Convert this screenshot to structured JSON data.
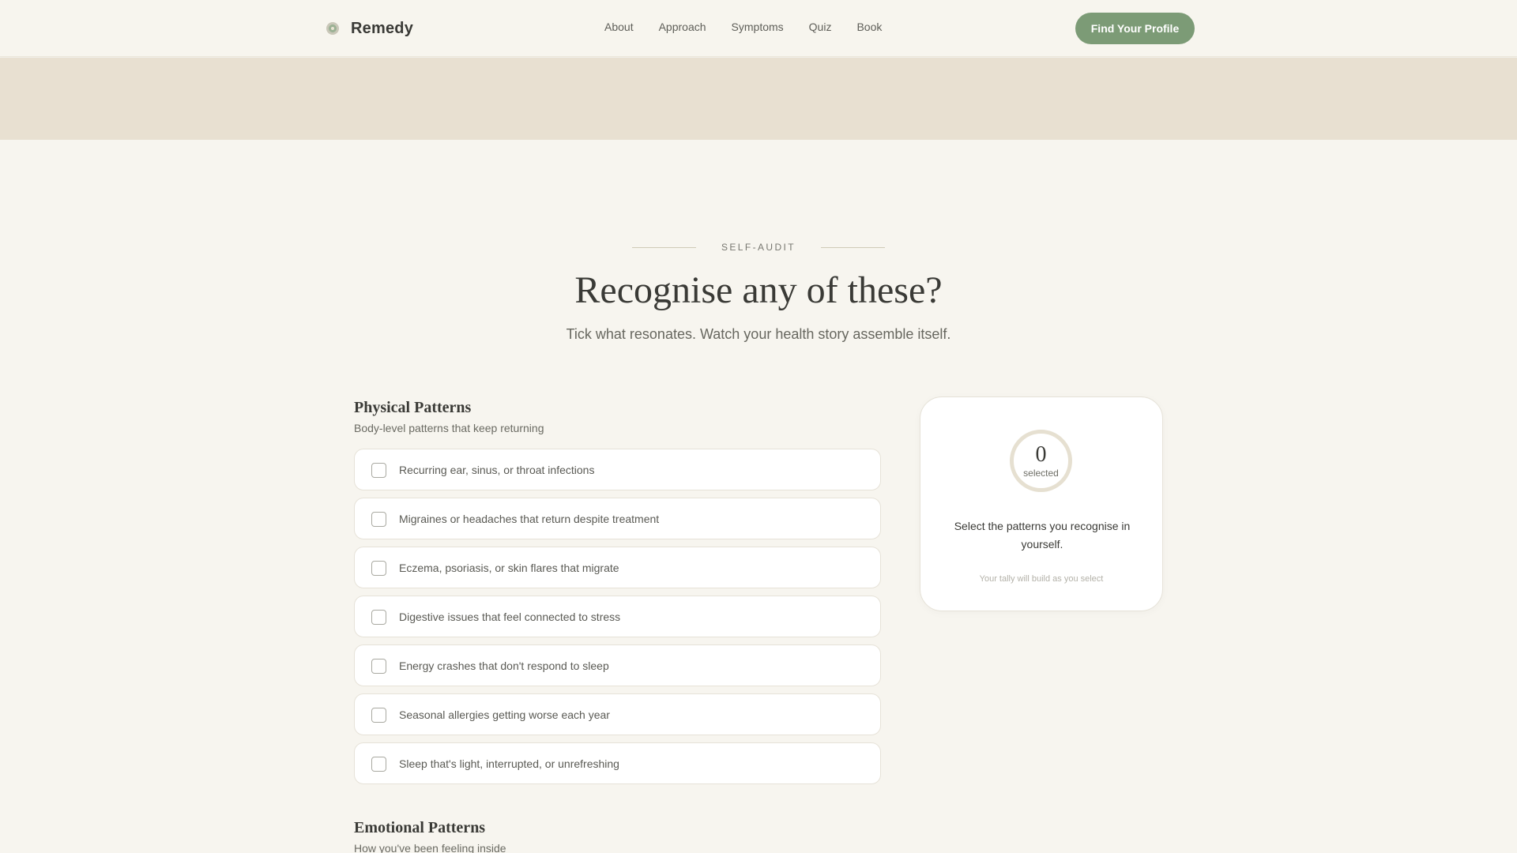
{
  "nav": {
    "brand": "Remedy",
    "links": [
      "About",
      "Approach",
      "Symptoms",
      "Quiz",
      "Book"
    ],
    "cta": "Find Your Profile"
  },
  "section": {
    "eyebrow": "SELF-AUDIT",
    "title": "Recognise any of these?",
    "subtitle": "Tick what resonates. Watch your health story assemble itself."
  },
  "groups": [
    {
      "title": "Physical Patterns",
      "subtitle": "Body-level patterns that keep returning",
      "items": [
        "Recurring ear, sinus, or throat infections",
        "Migraines or headaches that return despite treatment",
        "Eczema, psoriasis, or skin flares that migrate",
        "Digestive issues that feel connected to stress",
        "Energy crashes that don't respond to sleep",
        "Seasonal allergies getting worse each year",
        "Sleep that's light, interrupted, or unrefreshing"
      ]
    },
    {
      "title": "Emotional Patterns",
      "subtitle": "How you've been feeling inside"
    }
  ],
  "tally": {
    "count": "0",
    "count_label": "selected",
    "message": "Select the patterns you recognise in yourself.",
    "hint": "Your tally will build as you select"
  },
  "colors": {
    "accent": "#7c9b76",
    "background": "#f7f5ef",
    "band": "#e8e0d1"
  }
}
